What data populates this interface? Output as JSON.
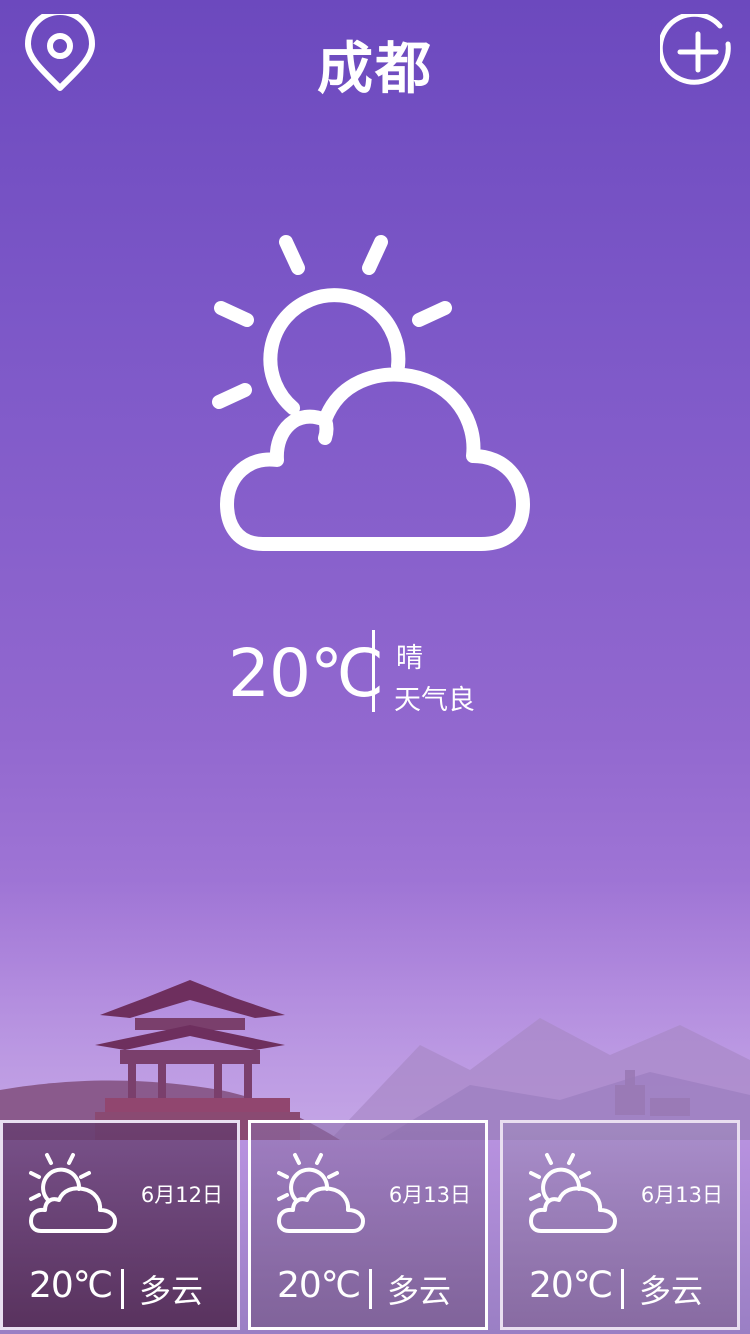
{
  "header": {
    "title": "成都",
    "location_icon": "location-pin-icon",
    "add_icon": "add-circle-icon"
  },
  "current": {
    "icon": "partly-cloudy-icon",
    "temperature": "20℃",
    "condition": "晴",
    "air_quality": "天气良"
  },
  "forecast": [
    {
      "icon": "partly-cloudy-icon",
      "date": "6月12日",
      "temperature": "20℃",
      "condition": "多云"
    },
    {
      "icon": "partly-cloudy-icon",
      "date": "6月13日",
      "temperature": "20℃",
      "condition": "多云"
    },
    {
      "icon": "partly-cloudy-icon",
      "date": "6月13日",
      "temperature": "20℃",
      "condition": "多云"
    }
  ],
  "colors": {
    "background_top": "#6c49be",
    "background_bottom": "#b892e0",
    "text": "#ffffff"
  }
}
